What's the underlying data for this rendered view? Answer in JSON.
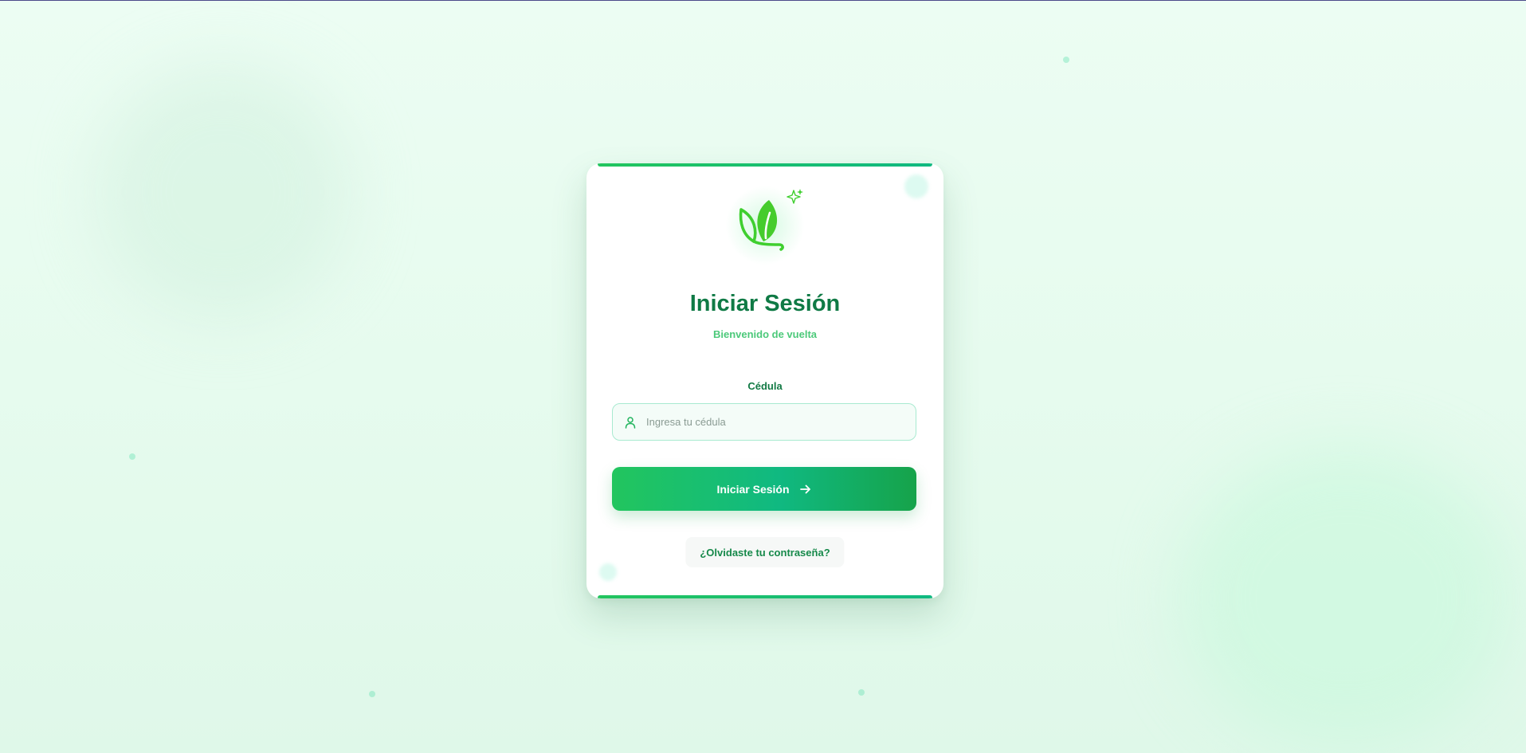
{
  "login": {
    "title": "Iniciar Sesión",
    "subtitle": "Bienvenido de vuelta",
    "field_label": "Cédula",
    "field_placeholder": "Ingresa tu cédula",
    "field_value": "",
    "submit_label": "Iniciar Sesión",
    "forgot_label": "¿Olvidaste tu contraseña?"
  },
  "icons": {
    "logo": "leaf-logo-icon",
    "sparkle": "sparkle-icon",
    "user": "user-icon",
    "arrow": "arrow-right-icon"
  },
  "colors": {
    "brand_green": "#16a34a",
    "title_green": "#0f7a45",
    "subtitle_green": "#4cc97a",
    "background": "#ecfdf3"
  }
}
